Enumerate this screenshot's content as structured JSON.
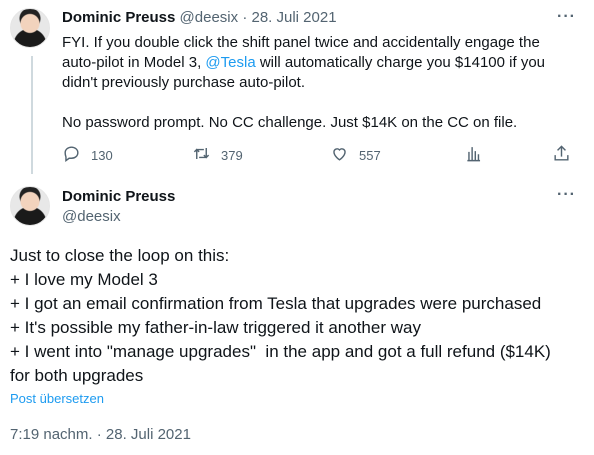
{
  "tweet1": {
    "name": "Dominic Preuss",
    "handle": "@deesix",
    "separator": "·",
    "date": "28. Juli 2021",
    "text_line1": "FYI. If you double click the shift panel twice and accidentally engage the",
    "text_line2_pre": "auto-pilot in Model 3, ",
    "text_mention": "@Tesla",
    "text_line2_post": " will automatically charge you $14100 if you",
    "text_line3": "didn't previously purchase auto-pilot.",
    "text_line4": "No password prompt. No CC challenge. Just $14K on the CC on file.",
    "replies": "130",
    "retweets": "379",
    "likes": "557"
  },
  "tweet2": {
    "name": "Dominic Preuss",
    "handle": "@deesix",
    "lines": [
      "Just to close the loop on this:",
      "+ I love my Model 3",
      "+ I got an email confirmation from Tesla that upgrades were purchased",
      "+ It's possible my father-in-law triggered it another way",
      "+ I went into \"manage upgrades\"  in the app and got a full refund ($14K)",
      "for both upgrades"
    ],
    "translate_label": "Post übersetzen",
    "timestamp": "7:19 nachm. · 28. Juli 2021"
  },
  "icons": {
    "more": "more-icon",
    "reply": "reply-icon",
    "retweet": "retweet-icon",
    "like": "heart-icon",
    "analytics": "analytics-icon",
    "share": "share-icon"
  },
  "colors": {
    "accent": "#1d9bf0",
    "muted": "#536471",
    "text": "#0f1419"
  }
}
